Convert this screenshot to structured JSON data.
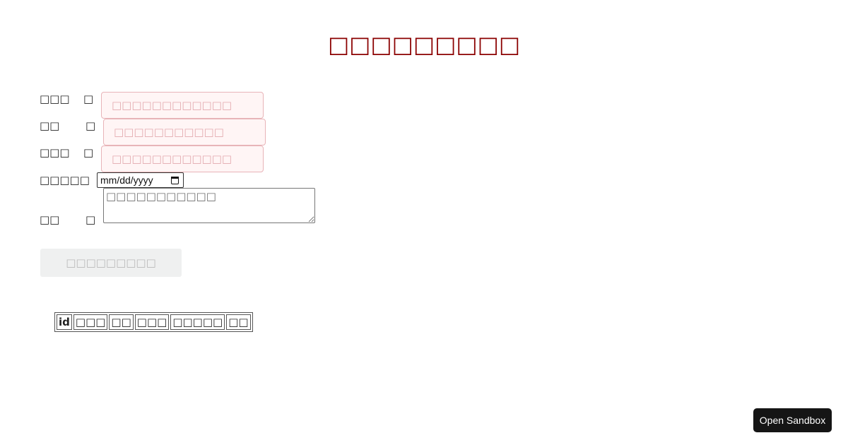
{
  "page": {
    "title": "□□□□□□□□□"
  },
  "form": {
    "fields": [
      {
        "label": "□□□",
        "required_mark": "□",
        "placeholder": "□□□□□□□□□□□□"
      },
      {
        "label": "□□",
        "required_mark": "□",
        "placeholder": "□□□□□□□□□□□"
      },
      {
        "label": "□□□",
        "required_mark": "□",
        "placeholder": "□□□□□□□□□□□□"
      }
    ],
    "date": {
      "label": "□□□□□",
      "value": "mm/dd/yyyy",
      "icon": "calendar-icon"
    },
    "notes": {
      "label": "□□",
      "required_mark": "□",
      "placeholder": "□□□□□□□□□□□"
    },
    "submit_label": "□□□□□□□□□"
  },
  "table": {
    "headers": [
      "id",
      "□□□",
      "□□",
      "□□□",
      "□□□□□",
      "□□"
    ]
  },
  "sandbox_button": {
    "label": "Open Sandbox"
  },
  "colors": {
    "title": "#8b0000",
    "field_border": "#e8b4b8",
    "field_background": "#fff5f5",
    "button_disabled": "#eff0f0",
    "sandbox_button": "#151515"
  }
}
